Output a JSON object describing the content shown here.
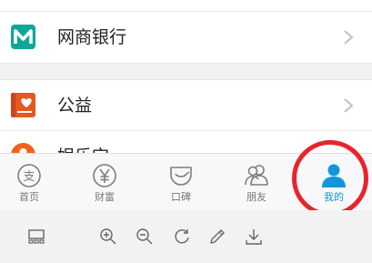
{
  "menu": {
    "items": [
      {
        "label": "网商银行",
        "icon": "mybank-icon",
        "color": "#12a59a"
      },
      {
        "label": "公益",
        "icon": "charity-book-icon",
        "color": "#e8571d"
      },
      {
        "label": "娱乐宝",
        "icon": "entertainment-icon",
        "color": "#f0611d"
      }
    ]
  },
  "tabbar": {
    "tabs": [
      {
        "label": "首页",
        "icon": "home-icon"
      },
      {
        "label": "财富",
        "icon": "wealth-yen-icon"
      },
      {
        "label": "口碑",
        "icon": "koubei-smile-icon"
      },
      {
        "label": "朋友",
        "icon": "friends-icon"
      },
      {
        "label": "我的",
        "icon": "profile-icon",
        "active": true
      }
    ],
    "active_color": "#1296db",
    "highlight_color": "#e8242a"
  },
  "viewer_toolbar": {
    "tools": [
      "thumbnail-icon",
      "zoom-in-icon",
      "zoom-out-icon",
      "rotate-icon",
      "edit-icon",
      "download-icon"
    ]
  }
}
